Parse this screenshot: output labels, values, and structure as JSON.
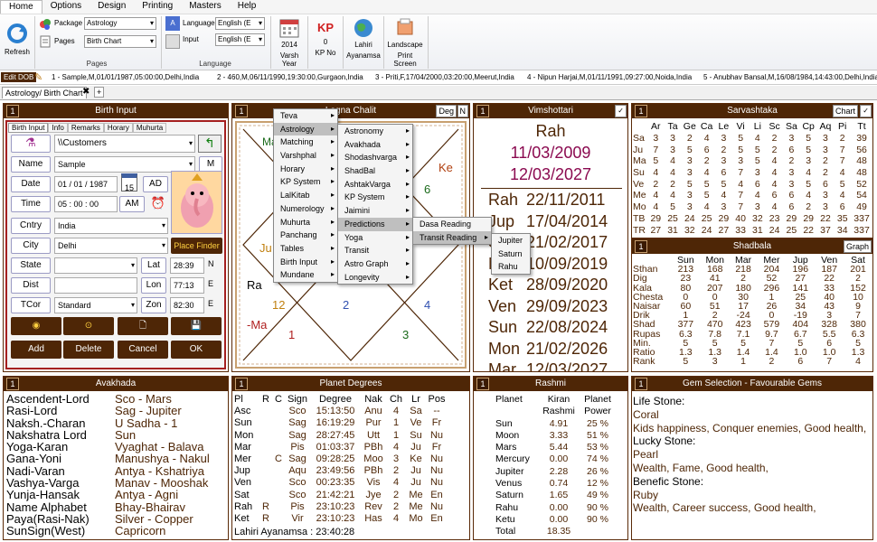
{
  "menubar": [
    "Home",
    "Options",
    "Design",
    "Printing",
    "Masters",
    "Help"
  ],
  "ribbon": {
    "refresh": "Refresh",
    "package_label": "Package",
    "package_value": "Astrology",
    "pages_label": "Pages",
    "pages_value": "Birth Chart",
    "pages_group": "Pages",
    "language_label": "Language",
    "language_value": "English (E",
    "input_label": "Input",
    "input_value": "English (E",
    "language_group": "Language",
    "varsh_year": "2014",
    "varsh_label": "Varsh Year",
    "kp_value": "0",
    "kp_label": "KP No",
    "lahiri_label": "Lahiri",
    "ayanamsa_label": "Ayanamsa",
    "landscape_label": "Landscape",
    "print_label": "Print Screen"
  },
  "profiles": {
    "edit": "Edit DOB",
    "items": [
      "1 - Sample,M,01/01/1987,05:00:00,Delhi,India",
      "2 - 460,M,06/11/1990,19:30:00,Gurgaon,India",
      "3 - Priti,F,17/04/2000,03:20:00,Meerut,India",
      "4 - Nipun Harjai,M,01/11/1991,09:27:00,Noida,India",
      "5 - Anubhav Bansal,M,16/08/1984,14:43:00,Delhi,India"
    ]
  },
  "doc_tab": "Astrology/ Birth Chart",
  "birth": {
    "num": "1",
    "title": "Birth Input",
    "tabs": [
      "Birth Input",
      "Info",
      "Remarks",
      "Horary",
      "Muhurta"
    ],
    "folder": "\\\\Customers",
    "name_label": "Name",
    "name_value": "Sample",
    "m": "M",
    "date_label": "Date",
    "date_value": "01 / 01 /  1987",
    "cal": "15",
    "ad": "AD",
    "time_label": "Time",
    "time_value": "05  :  00  :  00",
    "am": "AM",
    "cntry_label": "Cntry",
    "cntry_value": "India",
    "city_label": "City",
    "city_value": "Delhi",
    "place_finder": "Place Finder",
    "state_label": "State",
    "lat_label": "Lat",
    "lat_value": "28:39",
    "lat_dir": "N",
    "dist_label": "Dist",
    "lon_label": "Lon",
    "lon_value": "77:13",
    "lon_dir": "E",
    "tcor_label": "TCor",
    "tcor_value": "Standard",
    "zon_label": "Zon",
    "zon_value": "82:30",
    "zon_dir": "E",
    "actions": [
      "Add",
      "Delete",
      "Cancel",
      "OK"
    ]
  },
  "chalit": {
    "num": "1",
    "title": "Lagna Chalit",
    "deg": "Deg",
    "n": "N",
    "labels": {
      "Ma": "Ma",
      "Ke": "Ke",
      "n6": "6",
      "Ju": "Ju",
      "Ra": "Ra",
      "n12": "12",
      "n2": "2",
      "n4": "4",
      "Ma2": "-Ma",
      "n1": "1",
      "n3": "3"
    }
  },
  "menu1": [
    "Teva",
    "Astrology",
    "Matching",
    "Varshphal",
    "Horary",
    "KP System",
    "LalKitab",
    "Numerology",
    "Muhurta",
    "Panchang",
    "Tables",
    "Birth Input",
    "Mundane"
  ],
  "menu2": [
    "Astronomy",
    "Avakhada",
    "Shodashvarga",
    "ShadBal",
    "AshtakVarga",
    "KP System",
    "Jaimini",
    "Predictions",
    "Yoga",
    "Transit",
    "Astro Graph",
    "Longevity"
  ],
  "menu3": [
    "Dasa Reading",
    "Transit Reading"
  ],
  "menu4": [
    "Jupiter",
    "Saturn",
    "Rahu"
  ],
  "vim": {
    "num": "1",
    "title": "Vimshottari",
    "head": "Rah",
    "start": "11/03/2009",
    "end": "12/03/2027",
    "rows": [
      [
        "Rah",
        "22/11/2011"
      ],
      [
        "Jup",
        "17/04/2014"
      ],
      [
        "Sat",
        "21/02/2017"
      ],
      [
        "Mer",
        "10/09/2019"
      ],
      [
        "Ket",
        "28/09/2020"
      ],
      [
        "Ven",
        "29/09/2023"
      ],
      [
        "Sun",
        "22/08/2024"
      ],
      [
        "Mon",
        "21/02/2026"
      ],
      [
        "Mar",
        "12/03/2027"
      ]
    ]
  },
  "sarva": {
    "num": "1",
    "title": "Sarvashtaka",
    "chart": "Chart",
    "cols": [
      "",
      "Ar",
      "Ta",
      "Ge",
      "Ca",
      "Le",
      "Vi",
      "Li",
      "Sc",
      "Sa",
      "Cp",
      "Aq",
      "Pi",
      "Tt"
    ],
    "rows": [
      [
        "Sa",
        "3",
        "3",
        "2",
        "4",
        "3",
        "5",
        "4",
        "2",
        "3",
        "5",
        "3",
        "2",
        "39"
      ],
      [
        "Ju",
        "7",
        "3",
        "5",
        "6",
        "2",
        "5",
        "5",
        "2",
        "6",
        "5",
        "3",
        "7",
        "56"
      ],
      [
        "Ma",
        "5",
        "4",
        "3",
        "2",
        "3",
        "3",
        "5",
        "4",
        "2",
        "3",
        "2",
        "7",
        "48"
      ],
      [
        "Su",
        "4",
        "4",
        "3",
        "4",
        "6",
        "7",
        "3",
        "4",
        "3",
        "4",
        "2",
        "4",
        "48"
      ],
      [
        "Ve",
        "2",
        "2",
        "5",
        "5",
        "5",
        "4",
        "6",
        "4",
        "3",
        "5",
        "6",
        "5",
        "52"
      ],
      [
        "Me",
        "4",
        "4",
        "3",
        "5",
        "4",
        "7",
        "4",
        "6",
        "6",
        "4",
        "3",
        "4",
        "54"
      ],
      [
        "Mo",
        "4",
        "5",
        "3",
        "4",
        "3",
        "7",
        "3",
        "4",
        "6",
        "2",
        "3",
        "6",
        "49"
      ],
      [
        "TB",
        "29",
        "25",
        "24",
        "25",
        "29",
        "40",
        "32",
        "23",
        "29",
        "29",
        "22",
        "35",
        "337"
      ],
      [
        "TR",
        "27",
        "31",
        "32",
        "24",
        "27",
        "33",
        "31",
        "24",
        "25",
        "22",
        "37",
        "34",
        "337"
      ]
    ]
  },
  "shad": {
    "num": "1",
    "title": "Shadbala",
    "graph": "Graph",
    "cols": [
      "",
      "Sun",
      "Mon",
      "Mar",
      "Mer",
      "Jup",
      "Ven",
      "Sat"
    ],
    "rows": [
      [
        "Sthan",
        "213",
        "168",
        "218",
        "204",
        "196",
        "187",
        "201"
      ],
      [
        "Dig",
        "23",
        "41",
        "2",
        "52",
        "27",
        "22",
        "2"
      ],
      [
        "Kala",
        "80",
        "207",
        "180",
        "296",
        "141",
        "33",
        "152"
      ],
      [
        "Chesta",
        "0",
        "0",
        "30",
        "1",
        "25",
        "40",
        "10"
      ],
      [
        "Naisar",
        "60",
        "51",
        "17",
        "26",
        "34",
        "43",
        "9"
      ],
      [
        "Drik",
        "1",
        "2",
        "-24",
        "0",
        "-19",
        "3",
        "7"
      ],
      [
        "Shad",
        "377",
        "470",
        "423",
        "579",
        "404",
        "328",
        "380"
      ],
      [
        "Rupas",
        "6.3",
        "7.8",
        "7.1",
        "9.7",
        "6.7",
        "5.5",
        "6.3"
      ],
      [
        "Min.",
        "5",
        "5",
        "5",
        "7",
        "5",
        "6",
        "5"
      ],
      [
        "Ratio",
        "1.3",
        "1.3",
        "1.4",
        "1.4",
        "1.0",
        "1.0",
        "1.3"
      ],
      [
        "Rank",
        "5",
        "3",
        "1",
        "2",
        "6",
        "7",
        "4"
      ]
    ]
  },
  "avak": {
    "num": "1",
    "title": "Avakhada",
    "rows": [
      [
        "Ascendent-Lord",
        "Sco - Mars"
      ],
      [
        "Rasi-Lord",
        "Sag - Jupiter"
      ],
      [
        "Naksh.-Charan",
        "U Sadha - 1"
      ],
      [
        "Nakshatra Lord",
        "Sun"
      ],
      [
        "Yoga-Karan",
        "Vyaghat - Balava"
      ],
      [
        "Gana-Yoni",
        "Manushya - Nakul"
      ],
      [
        "Nadi-Varan",
        "Antya - Kshatriya"
      ],
      [
        "Vashya-Varga",
        "Manav - Mooshak"
      ],
      [
        "Yunja-Hansak",
        "Antya - Agni"
      ],
      [
        "Name Alphabet",
        "Bhay-Bhairav"
      ],
      [
        "Paya(Rasi-Nak)",
        "Silver - Copper"
      ],
      [
        "SunSign(West)",
        "Capricorn"
      ]
    ]
  },
  "pdeg": {
    "num": "1",
    "title": "Planet Degrees",
    "cols": [
      "Pl",
      "R",
      "C",
      "Sign",
      "Degree",
      "Nak",
      "Ch",
      "Lr",
      "Pos"
    ],
    "rows": [
      [
        "Asc",
        "",
        "",
        "Sco",
        "15:13:50",
        "Anu",
        "4",
        "Sa",
        "--"
      ],
      [
        "Sun",
        "",
        "",
        "Sag",
        "16:19:29",
        "Pur",
        "1",
        "Ve",
        "Fr"
      ],
      [
        "Mon",
        "",
        "",
        "Sag",
        "28:27:45",
        "Utt",
        "1",
        "Su",
        "Nu"
      ],
      [
        "Mar",
        "",
        "",
        "Pis",
        "01:03:37",
        "PBh",
        "4",
        "Ju",
        "Fr"
      ],
      [
        "Mer",
        "",
        "C",
        "Sag",
        "09:28:25",
        "Moo",
        "3",
        "Ke",
        "Nu"
      ],
      [
        "Jup",
        "",
        "",
        "Aqu",
        "23:49:56",
        "PBh",
        "2",
        "Ju",
        "Nu"
      ],
      [
        "Ven",
        "",
        "",
        "Sco",
        "00:23:35",
        "Vis",
        "4",
        "Ju",
        "Nu"
      ],
      [
        "Sat",
        "",
        "",
        "Sco",
        "21:42:21",
        "Jye",
        "2",
        "Me",
        "En"
      ],
      [
        "Rah",
        "R",
        "",
        "Pis",
        "23:10:23",
        "Rev",
        "2",
        "Me",
        "Nu"
      ],
      [
        "Ket",
        "R",
        "",
        "Vir",
        "23:10:23",
        "Has",
        "4",
        "Mo",
        "En"
      ]
    ],
    "ayanamsa": "Lahiri Ayanamsa : 23:40:28"
  },
  "rashmi": {
    "num": "1",
    "title": "Rashmi",
    "h1": [
      "Planet",
      "Kiran",
      "Planet"
    ],
    "h2": [
      "",
      "Rashmi",
      "Power"
    ],
    "rows": [
      [
        "Sun",
        "4.91",
        "25 %"
      ],
      [
        "Moon",
        "3.33",
        "51 %"
      ],
      [
        "Mars",
        "5.44",
        "53 %"
      ],
      [
        "Mercury",
        "0.00",
        "74 %"
      ],
      [
        "Jupiter",
        "2.28",
        "26 %"
      ],
      [
        "Venus",
        "0.74",
        "12 %"
      ],
      [
        "Saturn",
        "1.65",
        "49 %"
      ],
      [
        "Rahu",
        "0.00",
        "90 %"
      ],
      [
        "Ketu",
        "0.00",
        "90 %"
      ],
      [
        "Total",
        "18.35",
        ""
      ]
    ]
  },
  "gems": {
    "num": "1",
    "title": "Gem Selection - Favourable Gems",
    "lines": [
      "Life Stone:",
      "Coral",
      "Kids happiness, Conquer enemies, Good health,",
      "Lucky Stone:",
      "Pearl",
      "Wealth, Fame, Good health,",
      "Benefic Stone:",
      "Ruby",
      "Wealth, Career success, Good health,"
    ]
  },
  "colors": {
    "brown": "#4e2606",
    "menu_hl": "#bfbfbf",
    "vim_text": "#4e2606"
  }
}
